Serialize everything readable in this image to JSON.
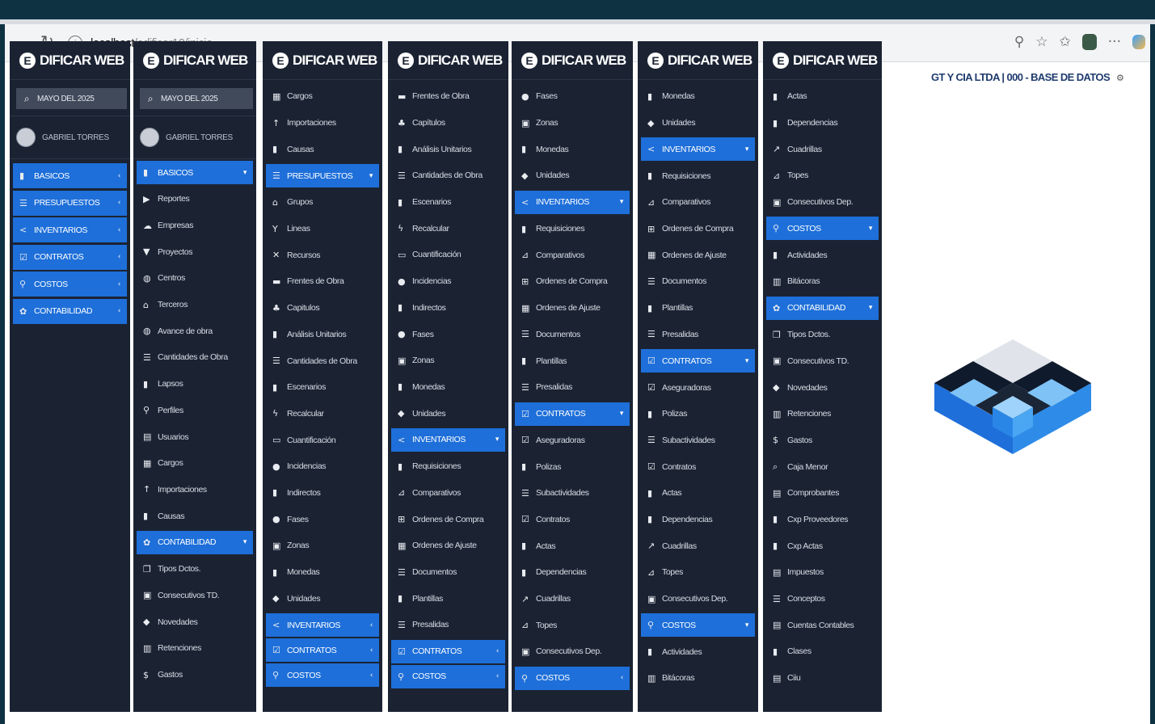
{
  "browser": {
    "url_host": "localhost",
    "url_path": "/edificar10/inicio"
  },
  "app": {
    "brand": "DIFICAR WEB",
    "brand_letter": "E",
    "company_header": "GT Y CIA LTDA  | 000 - BASE DE DATOS",
    "period": "MAYO DEL 2025",
    "user_name": "GABRIEL TORRES"
  },
  "colors": {
    "sidebar_bg": "#1b2333",
    "accent": "#1e6fd9",
    "page_bg": "#0e3242"
  },
  "panels": [
    {
      "items": [
        {
          "label": "BASICOS",
          "icon": "file",
          "active": true,
          "caret": "‹"
        },
        {
          "label": "PRESUPUESTOS",
          "icon": "list",
          "active": true,
          "caret": "‹"
        },
        {
          "label": "INVENTARIOS",
          "icon": "share",
          "active": true,
          "caret": "‹"
        },
        {
          "label": "CONTRATOS",
          "icon": "check",
          "active": true,
          "caret": "‹"
        },
        {
          "label": "COSTOS",
          "icon": "person",
          "active": true,
          "caret": "‹"
        },
        {
          "label": "CONTABILIDAD",
          "icon": "gear",
          "active": true,
          "caret": "‹"
        }
      ]
    },
    {
      "items": [
        {
          "label": "BASICOS",
          "icon": "file",
          "active": true,
          "caret": "▾"
        },
        {
          "label": "Reportes",
          "icon": "report"
        },
        {
          "label": "Empresas",
          "icon": "cloud"
        },
        {
          "label": "Proyectos",
          "icon": "bookmark"
        },
        {
          "label": "Centros",
          "icon": "globe"
        },
        {
          "label": "Terceros",
          "icon": "bank"
        },
        {
          "label": "Avance de obra",
          "icon": "globe"
        },
        {
          "label": "Cantidades de Obra",
          "icon": "list"
        },
        {
          "label": "Lapsos",
          "icon": "file"
        },
        {
          "label": "Perfiles",
          "icon": "person"
        },
        {
          "label": "Usuarios",
          "icon": "card"
        },
        {
          "label": "Cargos",
          "icon": "briefcase"
        },
        {
          "label": "Importaciones",
          "icon": "up"
        },
        {
          "label": "Causas",
          "icon": "file"
        },
        {
          "label": "CONTABILIDAD",
          "icon": "gear",
          "active": true,
          "caret": "▾"
        },
        {
          "label": "Tipos Dctos.",
          "icon": "copy"
        },
        {
          "label": "Consecutivos TD.",
          "icon": "box"
        },
        {
          "label": "Novedades",
          "icon": "shield"
        },
        {
          "label": "Retenciones",
          "icon": "calc"
        },
        {
          "label": "Gastos",
          "icon": "dollar"
        }
      ]
    },
    {
      "items": [
        {
          "label": "Cargos",
          "icon": "briefcase"
        },
        {
          "label": "Importaciones",
          "icon": "up"
        },
        {
          "label": "Causas",
          "icon": "file"
        },
        {
          "label": "PRESUPUESTOS",
          "icon": "list",
          "active": true,
          "caret": "▾"
        },
        {
          "label": "Grupos",
          "icon": "bank"
        },
        {
          "label": "Lineas",
          "icon": "tree"
        },
        {
          "label": "Recursos",
          "icon": "cross"
        },
        {
          "label": "Frentes de Obra",
          "icon": "folder"
        },
        {
          "label": "Capitulos",
          "icon": "sitemap"
        },
        {
          "label": "Análisis Unitarios",
          "icon": "file"
        },
        {
          "label": "Cantidades de Obra",
          "icon": "list"
        },
        {
          "label": "Escenarios",
          "icon": "file"
        },
        {
          "label": "Recalcular",
          "icon": "bolt"
        },
        {
          "label": "Cuantificación",
          "icon": "monitor"
        },
        {
          "label": "Incidencias",
          "icon": "dot"
        },
        {
          "label": "Indirectos",
          "icon": "file"
        },
        {
          "label": "Fases",
          "icon": "dot"
        },
        {
          "label": "Zonas",
          "icon": "box"
        },
        {
          "label": "Monedas",
          "icon": "file"
        },
        {
          "label": "Unidades",
          "icon": "tag"
        },
        {
          "label": "INVENTARIOS",
          "icon": "share",
          "active": true,
          "caret": "‹"
        },
        {
          "label": "CONTRATOS",
          "icon": "check",
          "active": true,
          "caret": "‹"
        },
        {
          "label": "COSTOS",
          "icon": "person",
          "active": true,
          "caret": "‹"
        }
      ]
    },
    {
      "items": [
        {
          "label": "Frentes de Obra",
          "icon": "folder"
        },
        {
          "label": "Capítulos",
          "icon": "sitemap"
        },
        {
          "label": "Análisis Unitarios",
          "icon": "file"
        },
        {
          "label": "Cantidades de Obra",
          "icon": "list"
        },
        {
          "label": "Escenarios",
          "icon": "file"
        },
        {
          "label": "Recalcular",
          "icon": "bolt"
        },
        {
          "label": "Cuantificación",
          "icon": "monitor"
        },
        {
          "label": "Incidencias",
          "icon": "dot"
        },
        {
          "label": "Indirectos",
          "icon": "file"
        },
        {
          "label": "Fases",
          "icon": "dot"
        },
        {
          "label": "Zonas",
          "icon": "box"
        },
        {
          "label": "Monedas",
          "icon": "file"
        },
        {
          "label": "Unidades",
          "icon": "tag"
        },
        {
          "label": "INVENTARIOS",
          "icon": "share",
          "active": true,
          "caret": "▾"
        },
        {
          "label": "Requisiciones",
          "icon": "file"
        },
        {
          "label": "Comparativos",
          "icon": "chart"
        },
        {
          "label": "Ordenes de Compra",
          "icon": "table"
        },
        {
          "label": "Ordenes de Ajuste",
          "icon": "grid"
        },
        {
          "label": "Documentos",
          "icon": "list"
        },
        {
          "label": "Plantillas",
          "icon": "file"
        },
        {
          "label": "Presalidas",
          "icon": "list"
        },
        {
          "label": "CONTRATOS",
          "icon": "check",
          "active": true,
          "caret": "‹"
        },
        {
          "label": "COSTOS",
          "icon": "person",
          "active": true,
          "caret": "‹"
        }
      ]
    },
    {
      "items": [
        {
          "label": "Fases",
          "icon": "dot"
        },
        {
          "label": "Zonas",
          "icon": "box"
        },
        {
          "label": "Monedas",
          "icon": "file"
        },
        {
          "label": "Unidades",
          "icon": "tag"
        },
        {
          "label": "INVENTARIOS",
          "icon": "share",
          "active": true,
          "caret": "▾"
        },
        {
          "label": "Requisiciones",
          "icon": "file"
        },
        {
          "label": "Comparativos",
          "icon": "chart"
        },
        {
          "label": "Ordenes de Compra",
          "icon": "table"
        },
        {
          "label": "Ordenes de Ajuste",
          "icon": "grid"
        },
        {
          "label": "Documentos",
          "icon": "list"
        },
        {
          "label": "Plantillas",
          "icon": "file"
        },
        {
          "label": "Presalidas",
          "icon": "list"
        },
        {
          "label": "CONTRATOS",
          "icon": "check",
          "active": true,
          "caret": "▾"
        },
        {
          "label": "Aseguradoras",
          "icon": "check"
        },
        {
          "label": "Polizas",
          "icon": "file"
        },
        {
          "label": "Subactividades",
          "icon": "list"
        },
        {
          "label": "Contratos",
          "icon": "check"
        },
        {
          "label": "Actas",
          "icon": "file"
        },
        {
          "label": "Dependencias",
          "icon": "file"
        },
        {
          "label": "Cuadrillas",
          "icon": "arrow"
        },
        {
          "label": "Topes",
          "icon": "chart"
        },
        {
          "label": "Consecutivos Dep.",
          "icon": "box"
        },
        {
          "label": "COSTOS",
          "icon": "person",
          "active": true,
          "caret": "‹"
        }
      ]
    },
    {
      "items": [
        {
          "label": "Monedas",
          "icon": "file"
        },
        {
          "label": "Unidades",
          "icon": "tag"
        },
        {
          "label": "INVENTARIOS",
          "icon": "share",
          "active": true,
          "caret": "▾"
        },
        {
          "label": "Requisiciones",
          "icon": "file"
        },
        {
          "label": "Comparativos",
          "icon": "chart"
        },
        {
          "label": "Ordenes de Compra",
          "icon": "table"
        },
        {
          "label": "Ordenes de Ajuste",
          "icon": "grid"
        },
        {
          "label": "Documentos",
          "icon": "list"
        },
        {
          "label": "Plantillas",
          "icon": "file"
        },
        {
          "label": "Presalidas",
          "icon": "list"
        },
        {
          "label": "CONTRATOS",
          "icon": "check",
          "active": true,
          "caret": "▾"
        },
        {
          "label": "Aseguradoras",
          "icon": "check"
        },
        {
          "label": "Polizas",
          "icon": "file"
        },
        {
          "label": "Subactividades",
          "icon": "list"
        },
        {
          "label": "Contratos",
          "icon": "check"
        },
        {
          "label": "Actas",
          "icon": "file"
        },
        {
          "label": "Dependencias",
          "icon": "file"
        },
        {
          "label": "Cuadrillas",
          "icon": "arrow"
        },
        {
          "label": "Topes",
          "icon": "chart"
        },
        {
          "label": "Consecutivos Dep.",
          "icon": "box"
        },
        {
          "label": "COSTOS",
          "icon": "person",
          "active": true,
          "caret": "▾"
        },
        {
          "label": "Actividades",
          "icon": "file"
        },
        {
          "label": "Bitácoras",
          "icon": "calc"
        }
      ]
    },
    {
      "items": [
        {
          "label": "Actas",
          "icon": "file"
        },
        {
          "label": "Dependencias",
          "icon": "file"
        },
        {
          "label": "Cuadrillas",
          "icon": "arrow"
        },
        {
          "label": "Topes",
          "icon": "chart"
        },
        {
          "label": "Consecutivos Dep.",
          "icon": "box"
        },
        {
          "label": "COSTOS",
          "icon": "person",
          "active": true,
          "caret": "▾"
        },
        {
          "label": "Actividades",
          "icon": "file"
        },
        {
          "label": "Bitácoras",
          "icon": "calc"
        },
        {
          "label": "CONTABILIDAD",
          "icon": "gear",
          "active": true,
          "caret": "▾"
        },
        {
          "label": "Tipos Dctos.",
          "icon": "copy"
        },
        {
          "label": "Consecutivos TD.",
          "icon": "box"
        },
        {
          "label": "Novedades",
          "icon": "shield"
        },
        {
          "label": "Retenciones",
          "icon": "calc"
        },
        {
          "label": "Gastos",
          "icon": "dollar"
        },
        {
          "label": "Caja Menor",
          "icon": "search"
        },
        {
          "label": "Comprobantes",
          "icon": "card"
        },
        {
          "label": "Cxp Proveedores",
          "icon": "file"
        },
        {
          "label": "Cxp Actas",
          "icon": "file"
        },
        {
          "label": "Impuestos",
          "icon": "card"
        },
        {
          "label": "Conceptos",
          "icon": "list"
        },
        {
          "label": "Cuentas Contables",
          "icon": "card"
        },
        {
          "label": "Clases",
          "icon": "file"
        },
        {
          "label": "Ciiu",
          "icon": "card"
        }
      ]
    }
  ]
}
